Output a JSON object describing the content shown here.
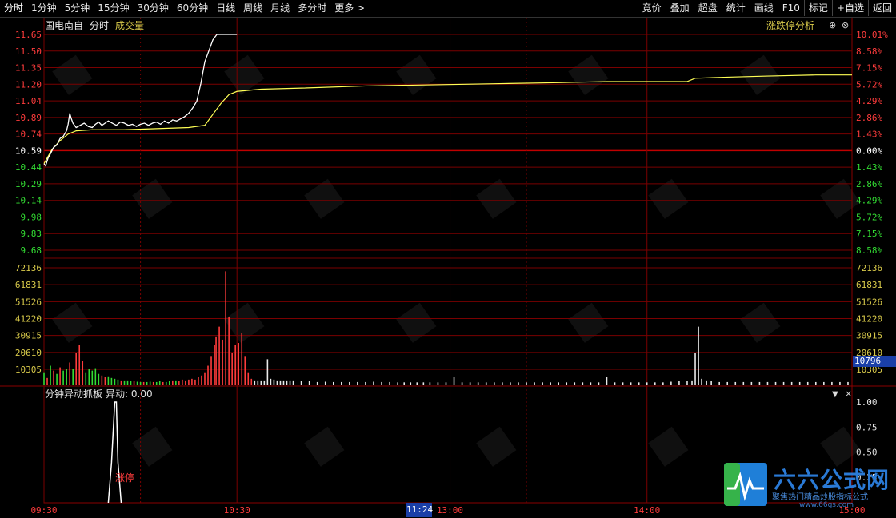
{
  "toolbar": {
    "left": [
      "分时",
      "1分钟",
      "5分钟",
      "15分钟",
      "30分钟",
      "60分钟",
      "日线",
      "周线",
      "月线",
      "多分时",
      "更多 >"
    ],
    "right": [
      "竞价",
      "叠加",
      "超盘",
      "统计",
      "画线",
      "F10",
      "标记",
      "+自选",
      "返回"
    ]
  },
  "info": {
    "stock_name": "国电南自",
    "period": "分时",
    "indicator": "成交量",
    "zt_analysis": "涨跌停分析"
  },
  "indicator_panel": {
    "title": "分钟异动抓板",
    "value_label": "异动: 0.00",
    "signal_label": "涨停"
  },
  "current_volume": "10796",
  "current_time": "11:24",
  "logo": {
    "title": "六六公式网",
    "subtitle": "聚焦热门精品炒股指标公式",
    "url": "www.66gs.com"
  },
  "colors": {
    "up": "#ff3c3c",
    "down": "#33dd33",
    "grid": "#7a0000",
    "price": "#ffffff",
    "avg": "#ffff55",
    "accent": "#1a3fa8"
  },
  "chart_data": {
    "type": "line",
    "price_axis_left": [
      "11.65",
      "11.50",
      "11.35",
      "11.20",
      "11.04",
      "10.89",
      "10.74",
      "10.59",
      "10.44",
      "10.29",
      "10.14",
      "9.98",
      "9.83",
      "9.68"
    ],
    "pct_axis_right": [
      "10.01%",
      "8.58%",
      "7.15%",
      "5.72%",
      "4.29%",
      "2.86%",
      "1.43%",
      "0.00%",
      "1.43%",
      "2.86%",
      "4.29%",
      "5.72%",
      "7.15%",
      "8.58%"
    ],
    "volume_axis": [
      "72136",
      "61831",
      "51526",
      "41220",
      "30915",
      "20610",
      "10305"
    ],
    "indicator_axis": [
      "1.00",
      "0.75",
      "0.50",
      "0.25"
    ],
    "x_ticks": [
      "09:30",
      "10:30",
      "13:00",
      "14:00",
      "15:00"
    ],
    "prev_close": 10.59,
    "ylim": [
      9.68,
      11.65
    ],
    "volume_max": 72136,
    "price_series": [
      [
        0,
        10.47
      ],
      [
        2,
        10.45
      ],
      [
        5,
        10.52
      ],
      [
        8,
        10.56
      ],
      [
        12,
        10.62
      ],
      [
        16,
        10.64
      ],
      [
        20,
        10.7
      ],
      [
        24,
        10.72
      ],
      [
        28,
        10.77
      ],
      [
        30,
        10.83
      ],
      [
        32,
        10.93
      ],
      [
        34,
        10.88
      ],
      [
        36,
        10.84
      ],
      [
        40,
        10.8
      ],
      [
        45,
        10.82
      ],
      [
        50,
        10.84
      ],
      [
        55,
        10.81
      ],
      [
        60,
        10.8
      ],
      [
        64,
        10.83
      ],
      [
        68,
        10.85
      ],
      [
        72,
        10.82
      ],
      [
        76,
        10.84
      ],
      [
        80,
        10.86
      ],
      [
        85,
        10.84
      ],
      [
        90,
        10.82
      ],
      [
        95,
        10.85
      ],
      [
        100,
        10.84
      ],
      [
        105,
        10.82
      ],
      [
        110,
        10.83
      ],
      [
        115,
        10.81
      ],
      [
        120,
        10.83
      ],
      [
        125,
        10.84
      ],
      [
        130,
        10.82
      ],
      [
        135,
        10.84
      ],
      [
        140,
        10.85
      ],
      [
        145,
        10.83
      ],
      [
        150,
        10.86
      ],
      [
        155,
        10.84
      ],
      [
        160,
        10.87
      ],
      [
        165,
        10.86
      ],
      [
        170,
        10.88
      ],
      [
        175,
        10.9
      ],
      [
        180,
        10.93
      ],
      [
        185,
        10.98
      ],
      [
        190,
        11.04
      ],
      [
        195,
        11.2
      ],
      [
        200,
        11.4
      ],
      [
        205,
        11.5
      ],
      [
        210,
        11.6
      ],
      [
        215,
        11.65
      ],
      [
        240,
        11.65
      ]
    ],
    "avg_series": [
      [
        0,
        10.47
      ],
      [
        10,
        10.6
      ],
      [
        20,
        10.68
      ],
      [
        30,
        10.74
      ],
      [
        40,
        10.77
      ],
      [
        60,
        10.78
      ],
      [
        100,
        10.78
      ],
      [
        140,
        10.79
      ],
      [
        180,
        10.8
      ],
      [
        200,
        10.82
      ],
      [
        210,
        10.92
      ],
      [
        220,
        11.02
      ],
      [
        230,
        11.1
      ],
      [
        240,
        11.13
      ],
      [
        270,
        11.15
      ],
      [
        320,
        11.16
      ],
      [
        400,
        11.18
      ],
      [
        480,
        11.19
      ],
      [
        560,
        11.2
      ],
      [
        640,
        11.21
      ],
      [
        700,
        11.22
      ],
      [
        760,
        11.22
      ],
      [
        800,
        11.22
      ],
      [
        810,
        11.25
      ],
      [
        850,
        11.26
      ],
      [
        900,
        11.27
      ],
      [
        960,
        11.28
      ],
      [
        1005,
        11.28
      ]
    ],
    "volumes": [
      [
        0,
        8000,
        "d"
      ],
      [
        4,
        4500,
        "u"
      ],
      [
        8,
        12000,
        "d"
      ],
      [
        12,
        9000,
        "u"
      ],
      [
        16,
        7000,
        "d"
      ],
      [
        20,
        11000,
        "u"
      ],
      [
        24,
        9000,
        "d"
      ],
      [
        28,
        10000,
        "d"
      ],
      [
        32,
        14000,
        "u"
      ],
      [
        36,
        10000,
        "d"
      ],
      [
        40,
        20000,
        "u"
      ],
      [
        44,
        25000,
        "u"
      ],
      [
        48,
        15000,
        "u"
      ],
      [
        52,
        8000,
        "d"
      ],
      [
        56,
        10000,
        "d"
      ],
      [
        60,
        9000,
        "d"
      ],
      [
        64,
        10500,
        "d"
      ],
      [
        68,
        7000,
        "d"
      ],
      [
        72,
        6000,
        "u"
      ],
      [
        76,
        5000,
        "u"
      ],
      [
        80,
        5500,
        "d"
      ],
      [
        84,
        4500,
        "d"
      ],
      [
        88,
        4000,
        "d"
      ],
      [
        92,
        3500,
        "d"
      ],
      [
        96,
        3000,
        "u"
      ],
      [
        100,
        3000,
        "d"
      ],
      [
        104,
        3000,
        "d"
      ],
      [
        108,
        2500,
        "d"
      ],
      [
        112,
        2500,
        "u"
      ],
      [
        116,
        2200,
        "d"
      ],
      [
        120,
        2000,
        "d"
      ],
      [
        124,
        2000,
        "u"
      ],
      [
        128,
        2000,
        "d"
      ],
      [
        132,
        2200,
        "d"
      ],
      [
        136,
        2000,
        "u"
      ],
      [
        140,
        2000,
        "d"
      ],
      [
        144,
        2500,
        "d"
      ],
      [
        148,
        2000,
        "u"
      ],
      [
        152,
        2000,
        "d"
      ],
      [
        156,
        2500,
        "d"
      ],
      [
        160,
        3000,
        "u"
      ],
      [
        164,
        3000,
        "d"
      ],
      [
        168,
        2500,
        "u"
      ],
      [
        172,
        3500,
        "u"
      ],
      [
        176,
        3000,
        "u"
      ],
      [
        180,
        3500,
        "u"
      ],
      [
        184,
        4000,
        "u"
      ],
      [
        188,
        3500,
        "u"
      ],
      [
        192,
        5000,
        "u"
      ],
      [
        196,
        6000,
        "u"
      ],
      [
        200,
        8000,
        "u"
      ],
      [
        204,
        12000,
        "u"
      ],
      [
        208,
        18000,
        "u"
      ],
      [
        212,
        25000,
        "u"
      ],
      [
        214,
        30000,
        "u"
      ],
      [
        218,
        36000,
        "u"
      ],
      [
        222,
        28000,
        "u"
      ],
      [
        226,
        70000,
        "u"
      ],
      [
        230,
        42000,
        "u"
      ],
      [
        234,
        20000,
        "u"
      ],
      [
        238,
        25000,
        "u"
      ],
      [
        242,
        26000,
        "u"
      ],
      [
        246,
        32000,
        "u"
      ],
      [
        250,
        18000,
        "u"
      ],
      [
        254,
        8000,
        "u"
      ],
      [
        258,
        4000,
        "u"
      ],
      [
        262,
        3000,
        "u"
      ],
      [
        266,
        3000,
        "u"
      ],
      [
        270,
        3000,
        "u"
      ],
      [
        274,
        3000,
        "u"
      ],
      [
        278,
        16000,
        "u"
      ],
      [
        282,
        4000,
        "u"
      ],
      [
        286,
        3500,
        "u"
      ],
      [
        290,
        3000,
        "u"
      ],
      [
        294,
        3000,
        "u"
      ],
      [
        298,
        3000,
        "u"
      ],
      [
        302,
        3000,
        "u"
      ],
      [
        306,
        3000,
        "u"
      ],
      [
        310,
        3000,
        "u"
      ],
      [
        320,
        2500,
        "u"
      ],
      [
        330,
        2500,
        "u"
      ],
      [
        340,
        2000,
        "u"
      ],
      [
        350,
        2200,
        "u"
      ],
      [
        360,
        2000,
        "u"
      ],
      [
        370,
        2000,
        "u"
      ],
      [
        380,
        2000,
        "u"
      ],
      [
        390,
        2000,
        "u"
      ],
      [
        400,
        2000,
        "u"
      ],
      [
        410,
        2200,
        "u"
      ],
      [
        420,
        2000,
        "u"
      ],
      [
        430,
        2000,
        "u"
      ],
      [
        440,
        1800,
        "u"
      ],
      [
        448,
        1800,
        "u"
      ],
      [
        456,
        1800,
        "u"
      ],
      [
        464,
        1800,
        "u"
      ],
      [
        472,
        1800,
        "u"
      ],
      [
        480,
        1800,
        "u"
      ],
      [
        490,
        1800,
        "u"
      ],
      [
        500,
        1800,
        "u"
      ],
      [
        510,
        5000,
        "u"
      ],
      [
        520,
        1800,
        "u"
      ],
      [
        530,
        1800,
        "u"
      ],
      [
        540,
        1800,
        "u"
      ],
      [
        550,
        1800,
        "u"
      ],
      [
        560,
        1800,
        "u"
      ],
      [
        570,
        1800,
        "u"
      ],
      [
        580,
        1800,
        "u"
      ],
      [
        590,
        1800,
        "u"
      ],
      [
        600,
        1800,
        "u"
      ],
      [
        610,
        1800,
        "u"
      ],
      [
        620,
        1800,
        "u"
      ],
      [
        630,
        1800,
        "u"
      ],
      [
        640,
        1800,
        "u"
      ],
      [
        650,
        1800,
        "u"
      ],
      [
        660,
        1800,
        "u"
      ],
      [
        670,
        1800,
        "u"
      ],
      [
        680,
        1800,
        "u"
      ],
      [
        690,
        1800,
        "u"
      ],
      [
        700,
        5000,
        "u"
      ],
      [
        710,
        1800,
        "u"
      ],
      [
        720,
        1800,
        "u"
      ],
      [
        730,
        1800,
        "u"
      ],
      [
        740,
        1800,
        "u"
      ],
      [
        750,
        1800,
        "u"
      ],
      [
        760,
        1800,
        "u"
      ],
      [
        770,
        1800,
        "u"
      ],
      [
        780,
        2200,
        "u"
      ],
      [
        790,
        2500,
        "u"
      ],
      [
        800,
        2800,
        "u"
      ],
      [
        806,
        3000,
        "u"
      ],
      [
        810,
        20000,
        "u"
      ],
      [
        814,
        36000,
        "u"
      ],
      [
        818,
        4000,
        "u"
      ],
      [
        824,
        3000,
        "u"
      ],
      [
        830,
        2500,
        "u"
      ],
      [
        840,
        2000,
        "u"
      ],
      [
        850,
        2000,
        "u"
      ],
      [
        860,
        2000,
        "u"
      ],
      [
        870,
        2000,
        "u"
      ],
      [
        880,
        2000,
        "u"
      ],
      [
        890,
        2000,
        "u"
      ],
      [
        900,
        2000,
        "u"
      ],
      [
        910,
        2000,
        "u"
      ],
      [
        920,
        2000,
        "u"
      ],
      [
        930,
        2000,
        "u"
      ],
      [
        940,
        2000,
        "u"
      ],
      [
        950,
        2000,
        "u"
      ],
      [
        960,
        2000,
        "u"
      ],
      [
        970,
        2000,
        "u"
      ],
      [
        980,
        2000,
        "u"
      ],
      [
        990,
        2000,
        "u"
      ],
      [
        1000,
        2000,
        "u"
      ]
    ],
    "indicator_spike": [
      [
        80,
        0
      ],
      [
        84,
        0.4
      ],
      [
        88,
        1.0
      ],
      [
        90,
        1.0
      ],
      [
        92,
        0.4
      ],
      [
        96,
        0
      ]
    ]
  }
}
